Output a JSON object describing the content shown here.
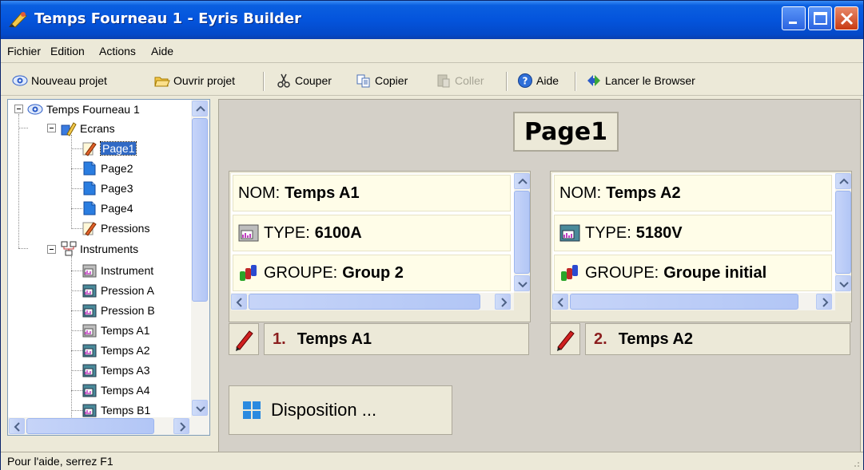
{
  "window": {
    "title": "Temps Fourneau 1 - Eyris Builder"
  },
  "menu": {
    "items": [
      "Fichier",
      "Edition",
      "Actions",
      "Aide"
    ]
  },
  "toolbar": {
    "new_project": "Nouveau projet",
    "open_project": "Ouvrir projet",
    "cut": "Couper",
    "copy": "Copier",
    "paste": "Coller",
    "help": "Aide",
    "launch_browser": "Lancer le Browser"
  },
  "tree": {
    "root": "Temps Fourneau 1",
    "screens_label": "Ecrans",
    "screens": [
      "Page1",
      "Page2",
      "Page3",
      "Page4",
      "Pressions"
    ],
    "instruments_label": "Instruments",
    "instruments": [
      "Instrument",
      "Pression A",
      "Pression B",
      "Temps A1",
      "Temps A2",
      "Temps A3",
      "Temps A4",
      "Temps B1"
    ],
    "selected": "Page1"
  },
  "page": {
    "title": "Page1",
    "cards": [
      {
        "nom_label": "NOM:",
        "nom": "Temps A1",
        "type_label": "TYPE:",
        "type": "6100A",
        "groupe_label": "GROUPE:",
        "groupe": "Group 2",
        "index": "1.",
        "footer_name": "Temps A1"
      },
      {
        "nom_label": "NOM:",
        "nom": "Temps A2",
        "type_label": "TYPE:",
        "type": "5180V",
        "groupe_label": "GROUPE:",
        "groupe": "Groupe initial",
        "index": "2.",
        "footer_name": "Temps A2"
      }
    ],
    "disposition_label": "Disposition ..."
  },
  "status": {
    "text": "Pour l'aide, serrez F1"
  }
}
